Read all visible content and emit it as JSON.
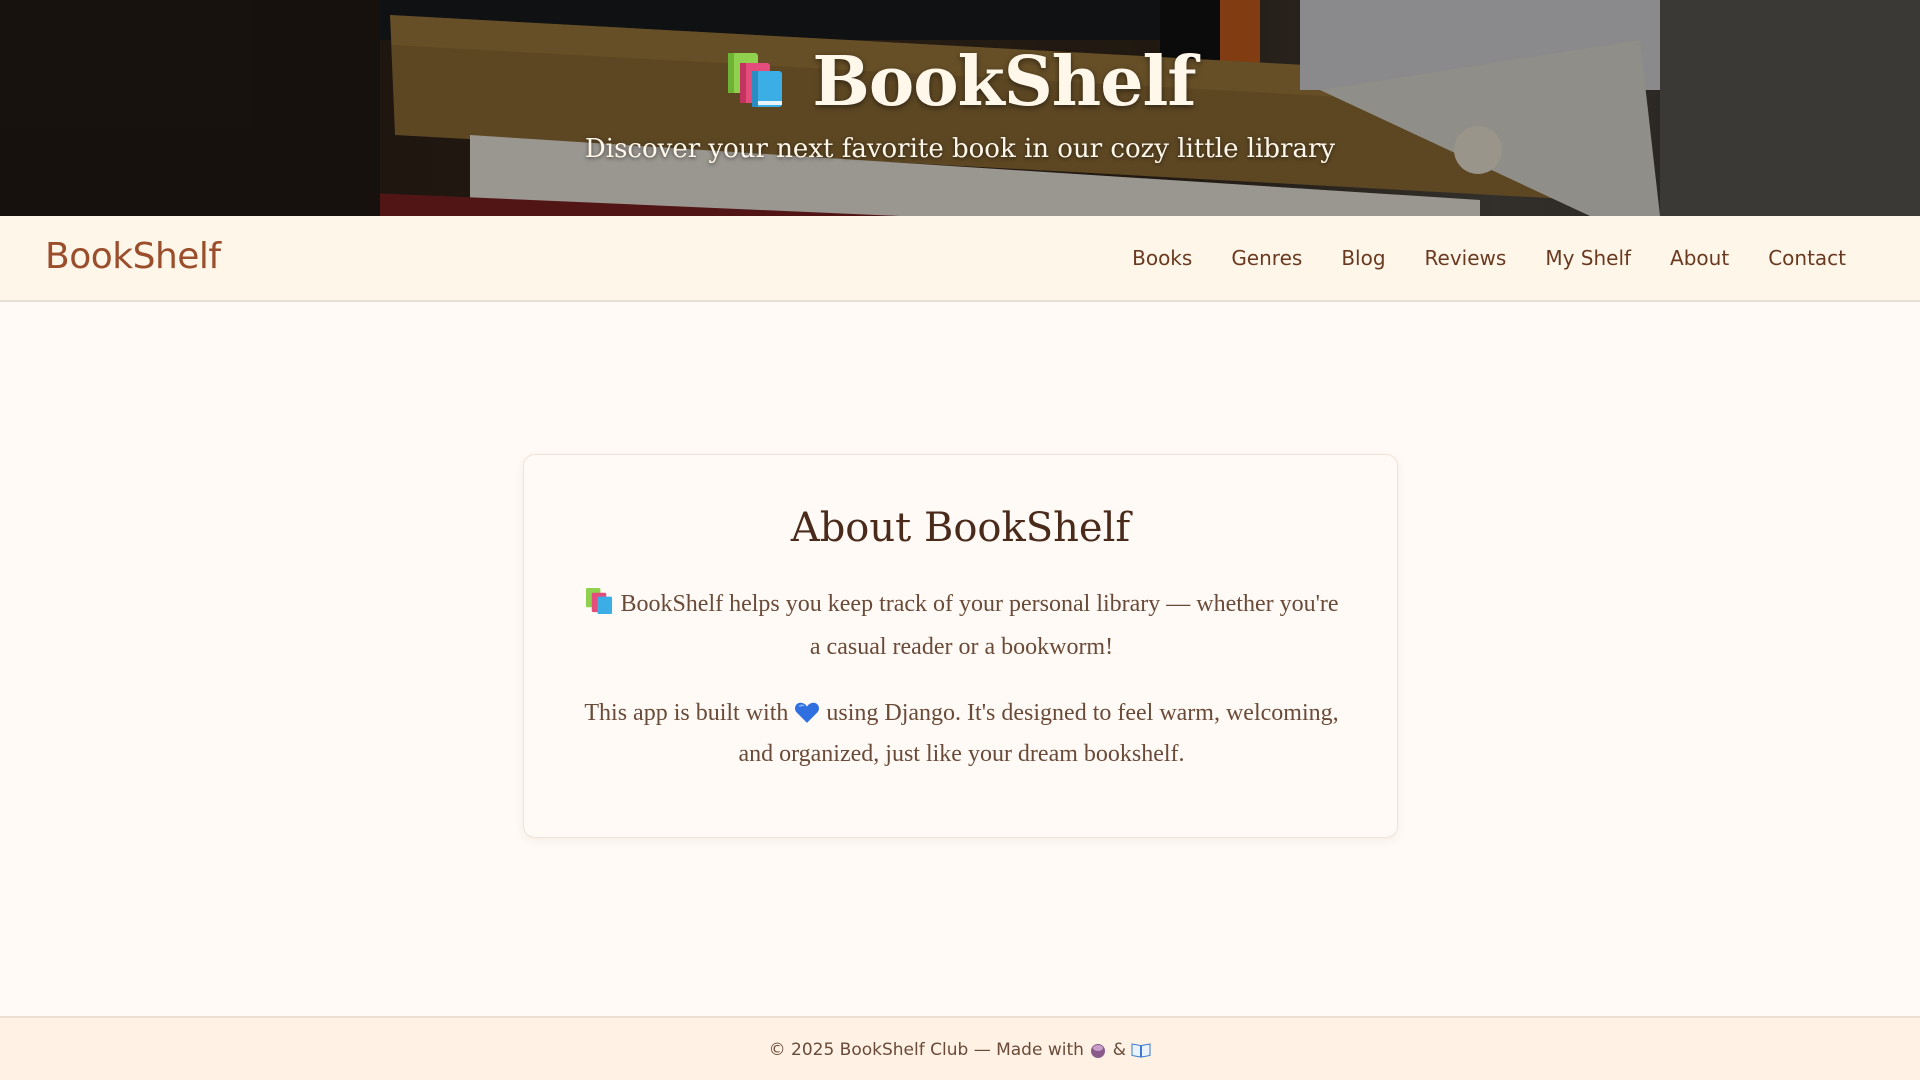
{
  "hero": {
    "title": "BookShelf",
    "subtitle": "Discover your next favorite book in our cozy little library",
    "icon": "books-icon"
  },
  "nav": {
    "brand": "BookShelf",
    "links": [
      "Books",
      "Genres",
      "Blog",
      "Reviews",
      "My Shelf",
      "About",
      "Contact"
    ]
  },
  "about": {
    "heading": "About BookShelf",
    "paragraph1": "BookShelf helps you keep track of your personal library — whether you're a casual reader or a bookworm!",
    "paragraph2_before": "This app is built with",
    "paragraph2_after": "using Django. It's designed to feel warm, welcoming, and organized, just like your dream bookshelf.",
    "heart_color": "#2f6fe0"
  },
  "footer": {
    "text_before": "© 2025 BookShelf Club — Made with",
    "separator": "&"
  },
  "colors": {
    "brand": "#9a4e2b",
    "nav_text": "#6a3a20",
    "background": "#fffaf5"
  }
}
